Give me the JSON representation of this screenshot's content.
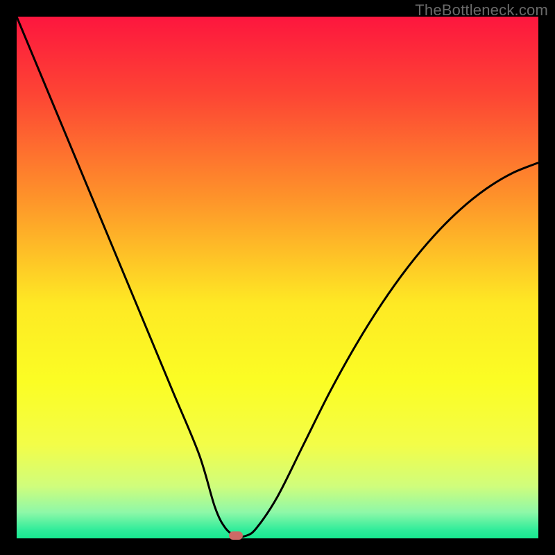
{
  "watermark": "TheBottleneck.com",
  "chart_data": {
    "type": "line",
    "title": "",
    "xlabel": "",
    "ylabel": "",
    "xlim": [
      0,
      100
    ],
    "ylim": [
      0,
      100
    ],
    "series": [
      {
        "name": "curve",
        "x": [
          0,
          5,
          10,
          15,
          20,
          25,
          30,
          35,
          38,
          40,
          42,
          44,
          46,
          50,
          55,
          60,
          65,
          70,
          75,
          80,
          85,
          90,
          95,
          100
        ],
        "values": [
          100,
          88,
          76,
          64,
          52,
          40,
          28,
          16,
          6,
          2,
          0.5,
          0.5,
          2,
          8,
          18,
          28,
          37,
          45,
          52,
          58,
          63,
          67,
          70,
          72
        ]
      }
    ],
    "marker": {
      "x": 42,
      "y": 0.5,
      "color": "#cd6a66"
    },
    "gradient_stops": [
      {
        "offset": 0.0,
        "color": "#fd163e"
      },
      {
        "offset": 0.15,
        "color": "#fd4534"
      },
      {
        "offset": 0.35,
        "color": "#fe942a"
      },
      {
        "offset": 0.55,
        "color": "#fee924"
      },
      {
        "offset": 0.7,
        "color": "#fbfd24"
      },
      {
        "offset": 0.82,
        "color": "#f3fd48"
      },
      {
        "offset": 0.9,
        "color": "#d0fd7c"
      },
      {
        "offset": 0.95,
        "color": "#8ef8a8"
      },
      {
        "offset": 0.985,
        "color": "#2dec9a"
      },
      {
        "offset": 1.0,
        "color": "#18e990"
      }
    ]
  }
}
